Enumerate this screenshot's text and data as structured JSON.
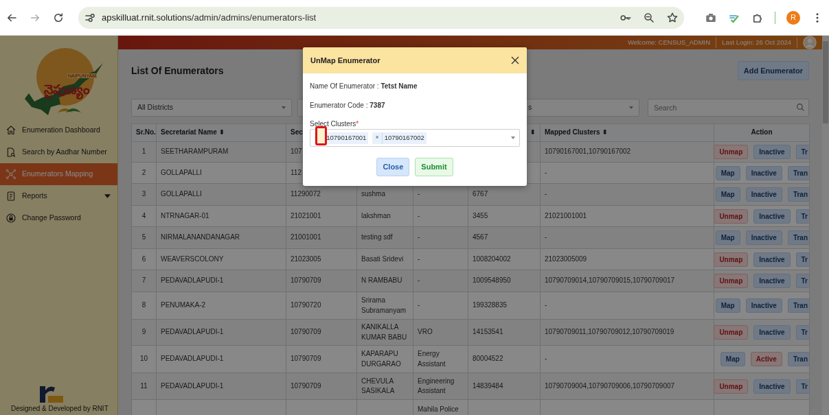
{
  "browser": {
    "url_host": "apskilluat.rnit.solutions",
    "url_path": "/admin/admins/enumerators-list",
    "profile_initial": "R"
  },
  "header": {
    "welcome": "Welcome: CENSUS_ADMIN",
    "last_login": "Last Login: 26 Oct 2024"
  },
  "sidebar": {
    "logo_caption": "NAIPUNYAM",
    "logo_text": "నైపుణ్యం",
    "items": [
      {
        "label": "Enumeration Dashboard",
        "kind": "home",
        "selected": false,
        "dropdown": false
      },
      {
        "label": "Search by Aadhar Number",
        "kind": "search-doc",
        "selected": false,
        "dropdown": false
      },
      {
        "label": "Enumerators Mapping",
        "kind": "network",
        "selected": true,
        "dropdown": false
      },
      {
        "label": "Reports",
        "kind": "report",
        "selected": false,
        "dropdown": true
      },
      {
        "label": "Change Password",
        "kind": "lock",
        "selected": false,
        "dropdown": false
      }
    ],
    "footer": "Designed & Developed by RNIT"
  },
  "page": {
    "title": "List Of Enumerators",
    "add_button": "Add Enumerator",
    "district_select": "All Districts",
    "second_select": "s",
    "search_placeholder": "Search"
  },
  "table": {
    "columns": [
      {
        "label": "Sr.No."
      },
      {
        "label": "Secretariat Name",
        "sort_mark": "⬍"
      },
      {
        "label": "Sec"
      },
      {},
      {},
      {
        "sort_mark": "⬍"
      },
      {
        "label": "Mapped Clusters",
        "sort_mark": "⬍"
      },
      {
        "label": "Action"
      }
    ],
    "rows": [
      {
        "cells": [
          "1",
          "SEETHARAMPURAM",
          "107",
          "",
          "",
          "",
          "10790167001,10790167002"
        ],
        "actions": [
          {
            "label": "Unmap",
            "kind": "unmap"
          },
          {
            "label": "Inactive",
            "kind": "status-off"
          },
          {
            "label": "Tr",
            "kind": "more"
          }
        ]
      },
      {
        "cells": [
          "2",
          "GOLLAPALLI",
          "112",
          "",
          "",
          "",
          "-"
        ],
        "actions": [
          {
            "label": "Map",
            "kind": "map"
          },
          {
            "label": "Inactive",
            "kind": "status-off"
          },
          {
            "label": "Tran",
            "kind": "more"
          }
        ]
      },
      {
        "cells": [
          "3",
          "GOLLAPALLI",
          "11290072",
          "sushma",
          "-",
          "6767",
          "-"
        ],
        "actions": [
          {
            "label": "Map",
            "kind": "map"
          },
          {
            "label": "Inactive",
            "kind": "status-off"
          },
          {
            "label": "Tran",
            "kind": "more"
          }
        ]
      },
      {
        "cells": [
          "4",
          "NTRNAGAR-01",
          "21021001",
          "lakshman",
          "-",
          "3455",
          "21021001001"
        ],
        "actions": [
          {
            "label": "Unmap",
            "kind": "unmap"
          },
          {
            "label": "Inactive",
            "kind": "status-off"
          },
          {
            "label": "Tr",
            "kind": "more"
          }
        ]
      },
      {
        "cells": [
          "5",
          "NIRMALANANDANAGAR",
          "21001001",
          "testing sdf",
          "-",
          "4567",
          "-"
        ],
        "actions": [
          {
            "label": "Map",
            "kind": "map"
          },
          {
            "label": "Inactive",
            "kind": "status-off"
          },
          {
            "label": "Tran",
            "kind": "more"
          }
        ]
      },
      {
        "cells": [
          "6",
          "WEAVERSCOLONY",
          "21023005",
          "Basati Sridevi",
          "-",
          "1008204002",
          "21023005009"
        ],
        "actions": [
          {
            "label": "Unmap",
            "kind": "unmap"
          },
          {
            "label": "Inactive",
            "kind": "status-off"
          },
          {
            "label": "Tr",
            "kind": "more"
          }
        ]
      },
      {
        "cells": [
          "7",
          "PEDAVADLAPUDI-1",
          "10790709",
          "N RAMBABU",
          "-",
          "1009548950",
          "10790709014,10790709015,10790709017"
        ],
        "actions": [
          {
            "label": "Unmap",
            "kind": "unmap"
          },
          {
            "label": "Inactive",
            "kind": "status-off"
          },
          {
            "label": "Tr",
            "kind": "more"
          }
        ]
      },
      {
        "cells": [
          "8",
          "PENUMAKA-2",
          "10790720",
          "Srirama Subramanyam",
          "-",
          "199328835",
          "-"
        ],
        "actions": [
          {
            "label": "Map",
            "kind": "map"
          },
          {
            "label": "Inactive",
            "kind": "status-off"
          },
          {
            "label": "Tran",
            "kind": "more"
          }
        ]
      },
      {
        "cells": [
          "9",
          "PEDAVADLAPUDI-1",
          "10790709",
          "KANIKALLA KUMAR BABU",
          "VRO",
          "14153541",
          "10790709011,10790709012,10790709019"
        ],
        "actions": [
          {
            "label": "Unmap",
            "kind": "unmap"
          },
          {
            "label": "Inactive",
            "kind": "status-off"
          },
          {
            "label": "Tr",
            "kind": "more"
          }
        ]
      },
      {
        "cells": [
          "10",
          "PEDAVADLAPUDI-1",
          "10790709",
          "KAPARAPU DURGARAO",
          "Energy Assistant",
          "80004522",
          "-"
        ],
        "actions": [
          {
            "label": "Map",
            "kind": "map"
          },
          {
            "label": "Active",
            "kind": "status-on"
          },
          {
            "label": "Tran",
            "kind": "more"
          }
        ]
      },
      {
        "cells": [
          "11",
          "PEDAVADLAPUDI-1",
          "10790709",
          "CHEVULA SASIKALA",
          "Engineering Assistant",
          "14839484",
          "10790709004,10790709006,10790709007"
        ],
        "actions": [
          {
            "label": "Unmap",
            "kind": "unmap"
          },
          {
            "label": "Inactive",
            "kind": "status-off"
          },
          {
            "label": "Tr",
            "kind": "more"
          }
        ]
      },
      {
        "cells": [
          "",
          "",
          "",
          "",
          "Mahila Police",
          "",
          ""
        ],
        "actions": []
      }
    ]
  },
  "modal": {
    "title": "UnMap Enumerator",
    "name_line": "Name Of Enumerator : **Tetst Name**",
    "code_line": "Enumerator Code : **7387**",
    "field_label": "Select Clusters",
    "required_mark": "*",
    "chips": [
      "10790167001",
      "10790167002"
    ],
    "chip_remove": "×",
    "close_button": "Close",
    "submit_button": "Submit",
    "annotation": true
  }
}
